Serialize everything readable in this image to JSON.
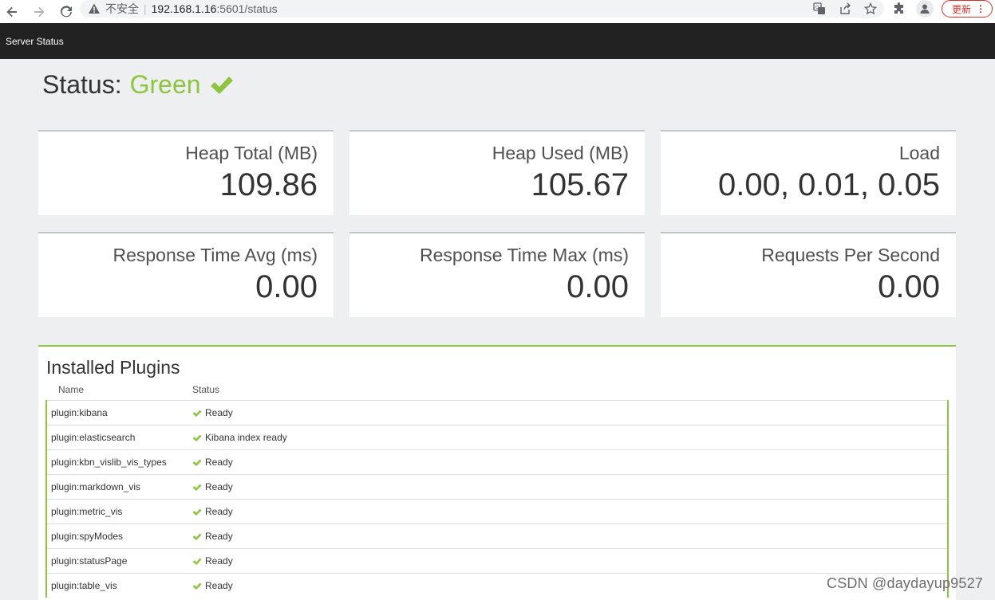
{
  "browser": {
    "insecure_label": "不安全",
    "url_host": "192.168.1.16",
    "url_path": ":5601/status",
    "update_label": "更新",
    "menu_label": "⋮"
  },
  "header": {
    "title": "Server Status"
  },
  "status": {
    "label": "Status:",
    "value": "Green",
    "color": "#8cc63f"
  },
  "metrics": [
    {
      "label": "Heap Total (MB)",
      "value": "109.86"
    },
    {
      "label": "Heap Used (MB)",
      "value": "105.67"
    },
    {
      "label": "Load",
      "value": "0.00, 0.01, 0.05"
    },
    {
      "label": "Response Time Avg (ms)",
      "value": "0.00"
    },
    {
      "label": "Response Time Max (ms)",
      "value": "0.00"
    },
    {
      "label": "Requests Per Second",
      "value": "0.00"
    }
  ],
  "plugins": {
    "title": "Installed Plugins",
    "columns": [
      "Name",
      "Status"
    ],
    "rows": [
      {
        "name": "plugin:kibana",
        "status": "Ready"
      },
      {
        "name": "plugin:elasticsearch",
        "status": "Kibana index ready"
      },
      {
        "name": "plugin:kbn_vislib_vis_types",
        "status": "Ready"
      },
      {
        "name": "plugin:markdown_vis",
        "status": "Ready"
      },
      {
        "name": "plugin:metric_vis",
        "status": "Ready"
      },
      {
        "name": "plugin:spyModes",
        "status": "Ready"
      },
      {
        "name": "plugin:statusPage",
        "status": "Ready"
      },
      {
        "name": "plugin:table_vis",
        "status": "Ready"
      }
    ]
  },
  "watermark": "CSDN @daydayup9527"
}
